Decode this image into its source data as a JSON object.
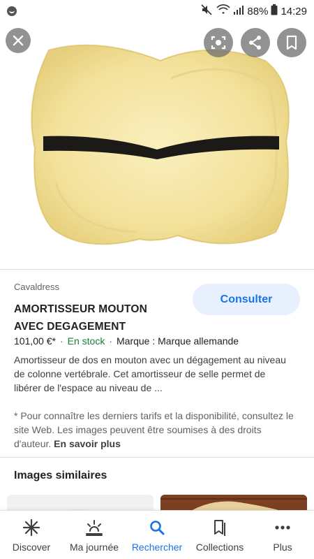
{
  "status_bar": {
    "battery": "88%",
    "time": "14:29"
  },
  "result": {
    "source": "Cavaldress",
    "title_line1": "AMORTISSEUR MOUTON",
    "title_line2": "AVEC DEGAGEMENT",
    "consult_label": "Consulter",
    "price": "101,00 €*",
    "stock": "En stock",
    "brand": "Marque : Marque allemande",
    "description": "Amortisseur de dos en mouton avec un dégagement au niveau de colonne vertébrale. Cet amortisseur de selle permet de libérer de l'espace au niveau de ...",
    "note": "* Pour connaître les derniers tarifs et la disponibilité, consultez le site Web. Les images peuvent être soumises à des droits d'auteur.",
    "learn_more": "En savoir plus"
  },
  "similar": {
    "title": "Images similaires"
  },
  "bottom_nav": [
    {
      "label": "Discover",
      "icon": "asterisk-icon"
    },
    {
      "label": "Ma journée",
      "icon": "sunrise-icon"
    },
    {
      "label": "Rechercher",
      "icon": "search-icon"
    },
    {
      "label": "Collections",
      "icon": "bookmarks-icon"
    },
    {
      "label": "Plus",
      "icon": "more-icon"
    }
  ],
  "colors": {
    "accent": "#1a73e8",
    "stock": "#188038",
    "fleece": "#f6e7a8",
    "strip": "#1c1a17"
  }
}
